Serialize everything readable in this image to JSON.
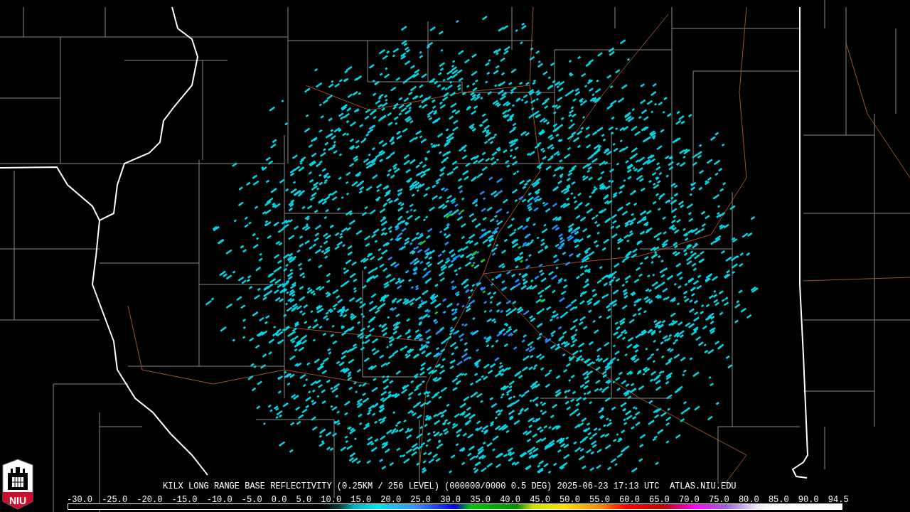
{
  "logo": {
    "text": "NIU"
  },
  "title": "KILX LONG RANGE BASE REFLECTIVITY (0.25KM / 256 LEVEL) (000000/0000 0.5 DEG) 2025-06-23 17:13 UTC  ATLAS.NIU.EDU",
  "scale_labels": [
    "-30.0",
    "-25.0",
    "-20.0",
    "-15.0",
    "-10.0",
    "-5.0",
    "0.0",
    "5.0",
    "10.0",
    "15.0",
    "20.0",
    "25.0",
    "30.0",
    "35.0",
    "40.0",
    "45.0",
    "50.0",
    "55.0",
    "60.0",
    "65.0",
    "70.0",
    "75.0",
    "80.0",
    "85.0",
    "90.0",
    "94.5"
  ]
}
